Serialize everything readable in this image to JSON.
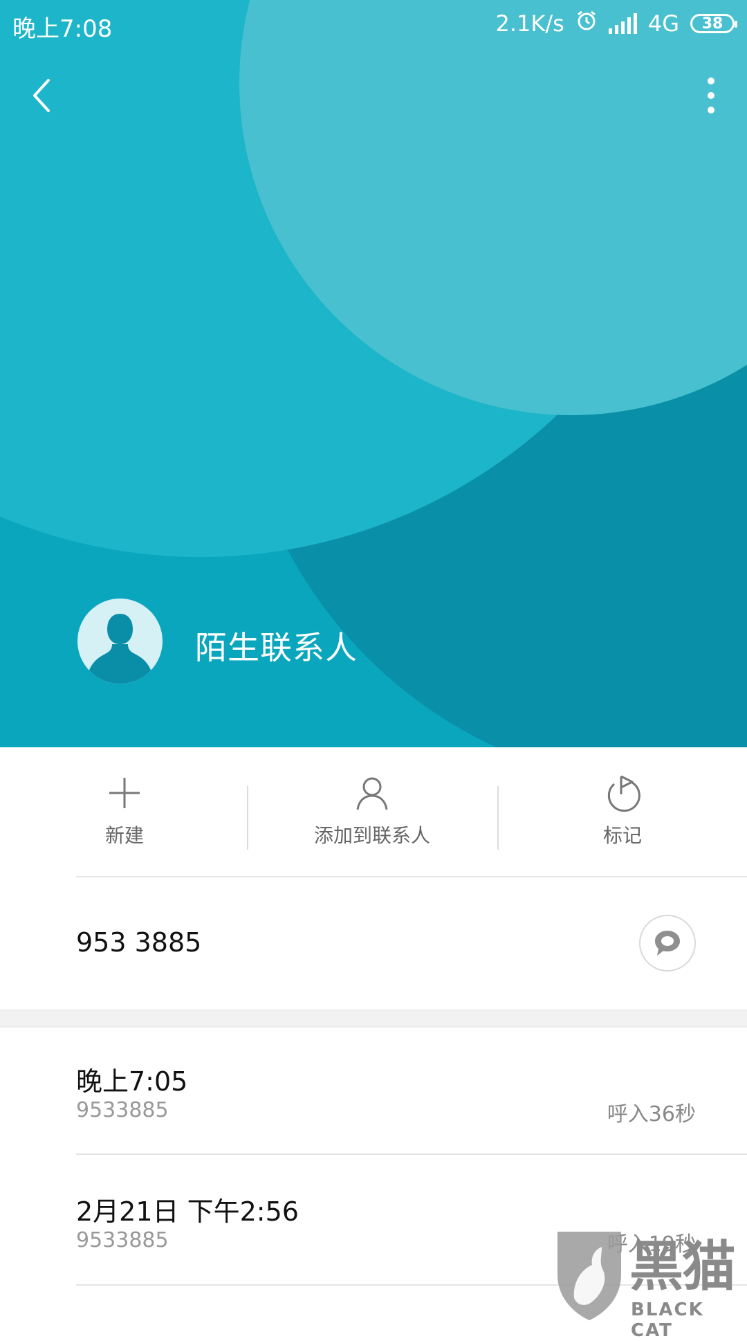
{
  "status_bar": {
    "time": "晚上7:08",
    "speed": "2.1K/s",
    "network": "4G",
    "battery": "38",
    "icons": [
      "alarm-icon",
      "signal-icon",
      "battery-icon"
    ]
  },
  "header": {
    "back_icon": "chevron-left-icon",
    "more_icon": "more-vertical-icon",
    "contact_name": "陌生联系人",
    "avatar_icon": "person-silhouette-icon",
    "colors": {
      "base": "#0AA6BE",
      "light": "#48C0CF",
      "mid": "#1DB5C9",
      "dark": "#0A8EA7"
    }
  },
  "actions": [
    {
      "label": "新建",
      "icon": "plus-icon"
    },
    {
      "label": "添加到联系人",
      "icon": "person-icon"
    },
    {
      "label": "标记",
      "icon": "flag-icon"
    }
  ],
  "number_row": {
    "phone": "953 3885",
    "message_icon": "message-bubble-icon"
  },
  "call_log": [
    {
      "time": "晚上7:05",
      "number": "9533885",
      "meta": "呼入36秒"
    },
    {
      "time": "2月21日 下午2:56",
      "number": "9533885",
      "meta": "呼入19秒"
    }
  ],
  "watermark": {
    "title": "黑猫",
    "subtitle": "BLACK CAT"
  }
}
